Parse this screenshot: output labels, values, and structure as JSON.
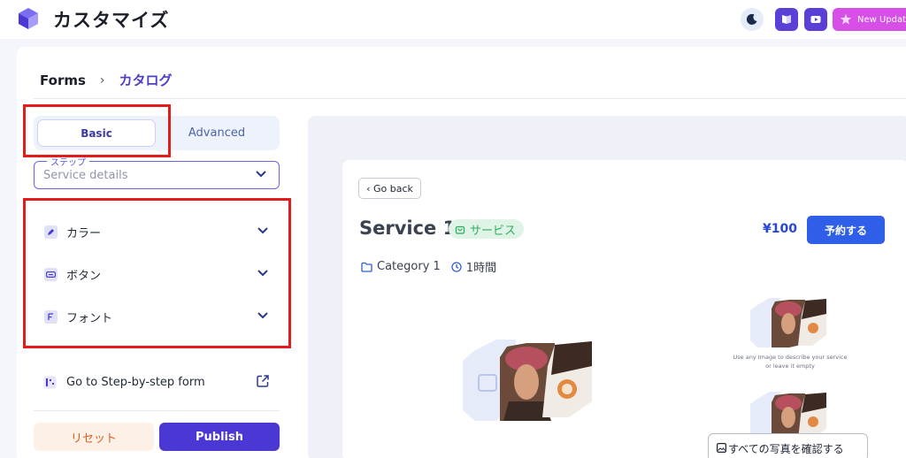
{
  "app": {
    "title": "カスタマイズ",
    "new_updates_label": "New Updates"
  },
  "breadcrumb": {
    "root": "Forms",
    "separator": "›",
    "current": "カタログ"
  },
  "mode_tabs": {
    "basic": "Basic",
    "advanced": "Advanced",
    "selected": "Basic"
  },
  "step_select": {
    "legend": "ステップ",
    "value": "Service details"
  },
  "sections": [
    {
      "label": "カラー",
      "icon": "paint-icon"
    },
    {
      "label": "ボタン",
      "icon": "button-icon"
    },
    {
      "label": "フォント",
      "icon": "font-icon"
    }
  ],
  "step_link": {
    "label": "Go to Step-by-step form"
  },
  "actions": {
    "reset": "リセット",
    "publish": "Publish"
  },
  "preview": {
    "back": "‹ Go back",
    "service_title": "Service 1",
    "badge": "サービス",
    "price": "¥100",
    "reserve": "予約する",
    "category": "Category 1",
    "duration": "1時間",
    "caption_line1": "Use any Image to describe your service",
    "caption_line2": "or leave it empty",
    "all_photos": "すべての写真を確認する"
  },
  "colors": {
    "primary": "#4b37d3",
    "accent_blue": "#2f5ee8",
    "badge_green": "#2fae5d",
    "reset_orange": "#e25a1c",
    "annotation_red": "#e31b1b"
  }
}
